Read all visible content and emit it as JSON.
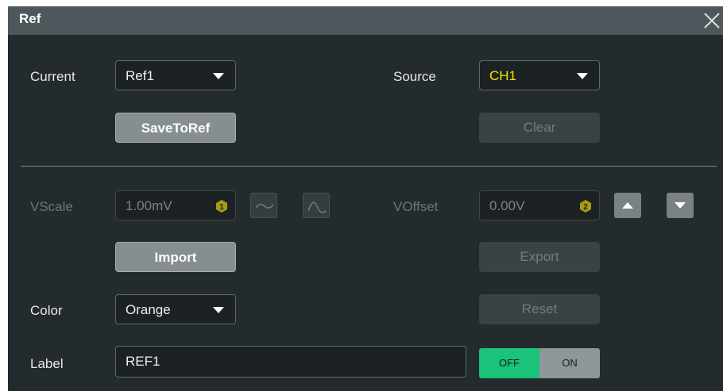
{
  "dialog": {
    "title": "Ref"
  },
  "current": {
    "label": "Current",
    "value": "Ref1"
  },
  "source": {
    "label": "Source",
    "value": "CH1",
    "value_color": "#f2e600"
  },
  "buttons": {
    "save_to_ref": "SaveToRef",
    "clear": "Clear",
    "import": "Import",
    "export": "Export",
    "reset": "Reset"
  },
  "vscale": {
    "label": "VScale",
    "value": "1.00mV",
    "badge": "1"
  },
  "voffset": {
    "label": "VOffset",
    "value": "0.00V",
    "badge": "2"
  },
  "color": {
    "label": "Color",
    "value": "Orange"
  },
  "label_field": {
    "label": "Label",
    "value": "REF1"
  },
  "toggle": {
    "off_label": "OFF",
    "on_label": "ON",
    "state": "OFF",
    "active_color": "#19c37a"
  },
  "icons": {
    "close": "close-icon",
    "vscale_fine": "sine-fine-icon",
    "vscale_coarse": "sine-coarse-icon",
    "offset_up": "arrow-up-icon",
    "offset_down": "arrow-down-icon"
  }
}
